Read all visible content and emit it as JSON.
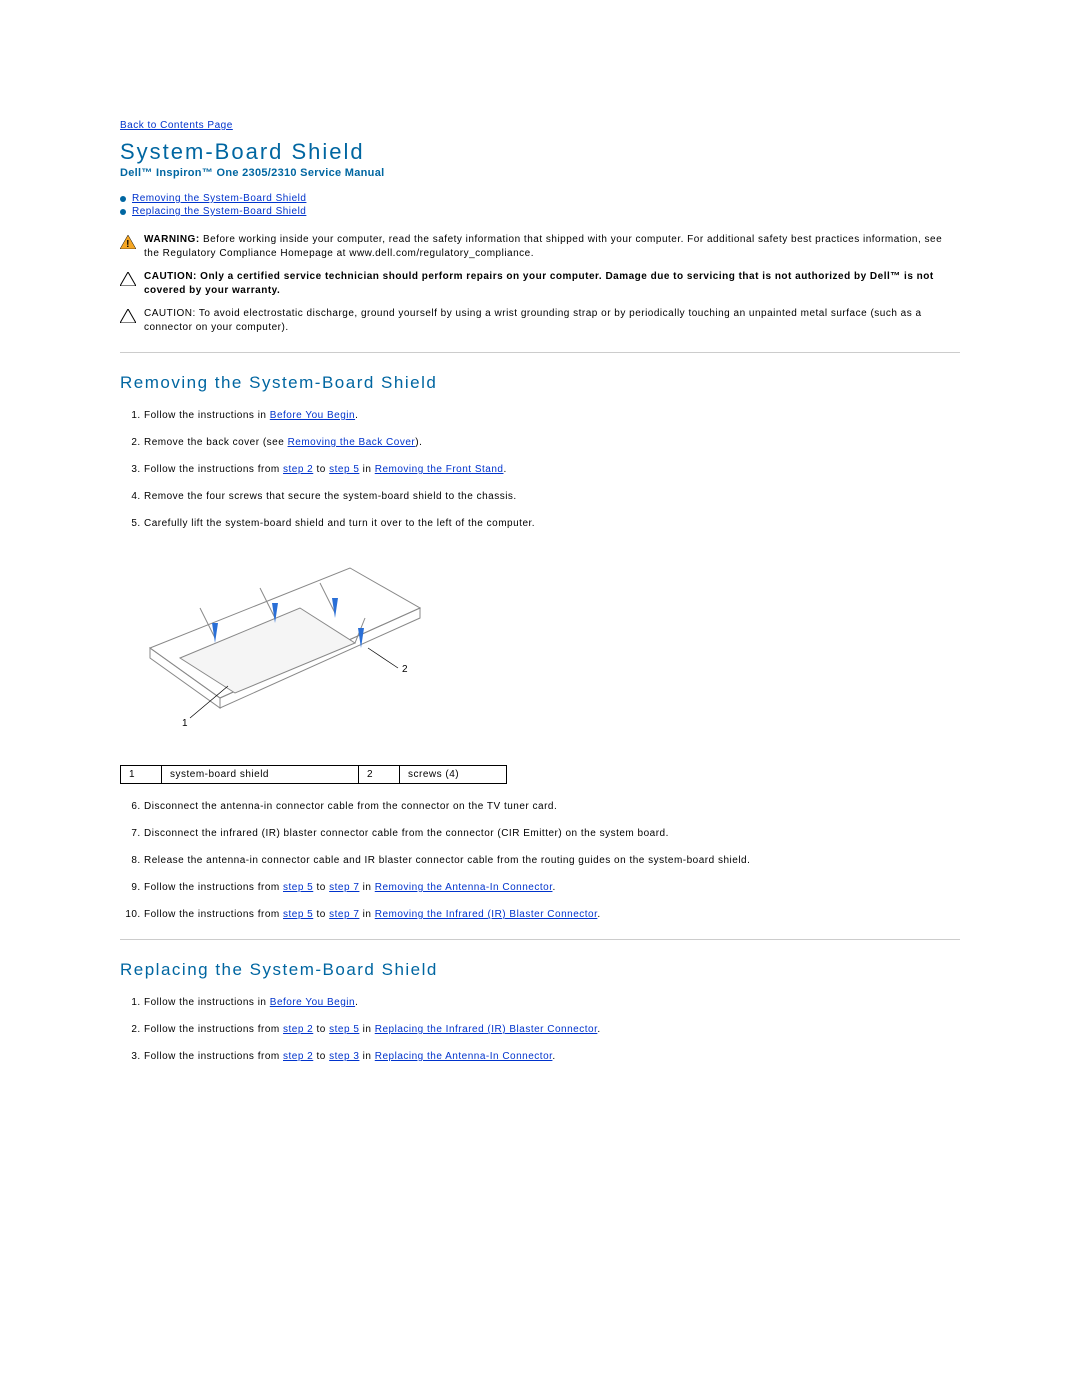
{
  "top_link": "Back to Contents Page",
  "page_title": "System-Board Shield",
  "manual_subtitle": "Dell™ Inspiron™ One 2305/2310 Service Manual",
  "toc_links": [
    "Removing the System-Board Shield",
    "Replacing the System-Board Shield"
  ],
  "notices": {
    "warning_label": "WARNING:",
    "warning_text": " Before working inside your computer, read the safety information that shipped with your computer. For additional safety best practices information, see the Regulatory Compliance Homepage at www.dell.com/regulatory_compliance.",
    "caution1_label": "CAUTION:",
    "caution1_text": " Only a certified service technician should perform repairs on your computer. Damage due to servicing that is not authorized by Dell™ is not covered by your warranty.",
    "caution2_label": "CAUTION:",
    "caution2_text": " To avoid electrostatic discharge, ground yourself by using a wrist grounding strap or by periodically touching an unpainted metal surface (such as a connector on your computer)."
  },
  "section1_title": "Removing the System-Board Shield",
  "remove_steps": {
    "s1_a": "Follow the instructions in ",
    "s1_link": "Before You Begin",
    "s1_b": ".",
    "s2_a": "Remove the back cover (see ",
    "s2_link": "Removing the Back Cover",
    "s2_b": ").",
    "s3_a": "Follow the instructions from ",
    "s3_l1": "step 2",
    "s3_mid": " to ",
    "s3_l2": "step 5",
    "s3_in": " in ",
    "s3_l3": "Removing the Front Stand",
    "s3_b": ".",
    "s4": "Remove the four screws that secure the system-board shield to the chassis.",
    "s5": "Carefully lift the system-board shield and turn it over to the left of the computer.",
    "s6": "Disconnect the antenna-in connector cable from the connector on the TV tuner card.",
    "s7": "Disconnect the infrared (IR) blaster connector cable from the connector (CIR Emitter) on the system board.",
    "s8": "Release the antenna-in connector cable and IR blaster connector cable from the routing guides on the system-board shield.",
    "s9_a": "Follow the instructions from ",
    "s9_l1": "step 5",
    "s9_mid": " to ",
    "s9_l2": "step 7",
    "s9_in": " in ",
    "s9_l3": "Removing the Antenna-In Connector",
    "s9_b": ".",
    "s10_a": "Follow the instructions from ",
    "s10_l1": "step 5",
    "s10_mid": " to ",
    "s10_l2": "step 7",
    "s10_in": " in ",
    "s10_l3": "Removing the Infrared (IR) Blaster Connector",
    "s10_b": "."
  },
  "legend": {
    "i1": "1",
    "t1": "system-board shield",
    "i2": "2",
    "t2": "screws (4)"
  },
  "diagram_labels": {
    "one": "1",
    "two": "2"
  },
  "section2_title": "Replacing the System-Board Shield",
  "replace_steps": {
    "s1_a": "Follow the instructions in ",
    "s1_link": "Before You Begin",
    "s1_b": ".",
    "s2_a": "Follow the instructions from ",
    "s2_l1": "step 2",
    "s2_mid": " to ",
    "s2_l2": "step 5",
    "s2_in": " in ",
    "s2_l3": "Replacing the Infrared (IR) Blaster Connector",
    "s2_b": ".",
    "s3_a": "Follow the instructions from ",
    "s3_l1": "step 2",
    "s3_mid": " to ",
    "s3_l2": "step 3",
    "s3_in": " in ",
    "s3_l3": "Replacing the Antenna-In Connector",
    "s3_b": "."
  }
}
